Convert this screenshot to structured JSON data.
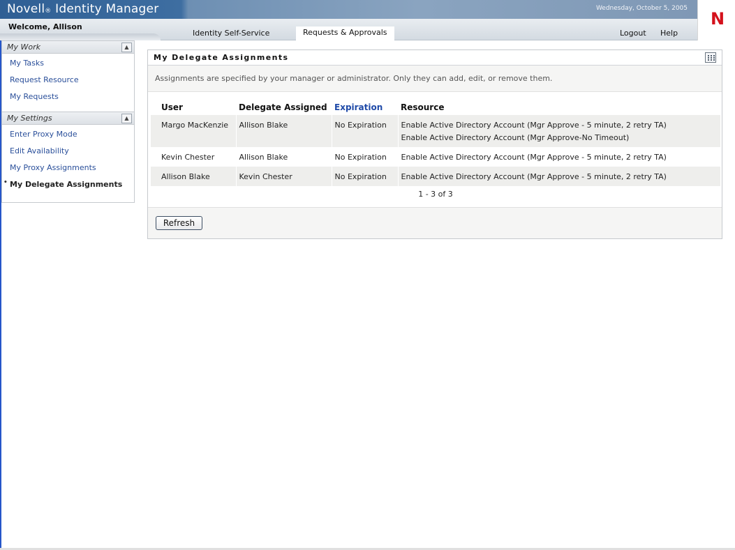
{
  "header": {
    "brand_name": "Novell",
    "brand_mark": "®",
    "brand_product": "Identity Manager",
    "date": "Wednesday, October 5, 2005",
    "logo_letter": "N",
    "welcome": "Welcome, Allison",
    "tabs": [
      {
        "label": "Identity Self-Service",
        "active": false
      },
      {
        "label": "Requests & Approvals",
        "active": true
      }
    ],
    "logout_label": "Logout",
    "help_label": "Help"
  },
  "sidebar": {
    "sections": [
      {
        "title": "My Work",
        "items": [
          {
            "label": "My Tasks"
          },
          {
            "label": "Request Resource"
          },
          {
            "label": "My Requests"
          }
        ]
      },
      {
        "title": "My Settings",
        "items": [
          {
            "label": "Enter Proxy Mode"
          },
          {
            "label": "Edit Availability"
          },
          {
            "label": "My Proxy Assignments"
          },
          {
            "label": "My Delegate Assignments",
            "active": true
          }
        ]
      }
    ],
    "collapse_icon": "double-chevron-up-icon"
  },
  "panel": {
    "title": "My Delegate Assignments",
    "menu_icon": "grid-menu-icon",
    "description": "Assignments are specified by your manager or administrator. Only they can add, edit, or remove them.",
    "columns": [
      "User",
      "Delegate Assigned",
      "Expiration",
      "Resource"
    ],
    "sort_column": "Expiration",
    "rows": [
      {
        "user": "Margo MacKenzie",
        "delegate": "Allison Blake",
        "expiration": "No Expiration",
        "resources": [
          "Enable Active Directory Account (Mgr Approve - 5 minute, 2 retry TA)",
          "Enable Active Directory Account (Mgr Approve-No Timeout)"
        ]
      },
      {
        "user": "Kevin Chester",
        "delegate": "Allison Blake",
        "expiration": "No Expiration",
        "resources": [
          "Enable Active Directory Account (Mgr Approve - 5 minute, 2 retry TA)"
        ]
      },
      {
        "user": "Allison Blake",
        "delegate": "Kevin Chester",
        "expiration": "No Expiration",
        "resources": [
          "Enable Active Directory Account (Mgr Approve - 5 minute, 2 retry TA)"
        ]
      }
    ],
    "pager": "1 - 3 of 3",
    "refresh_label": "Refresh"
  },
  "colors": {
    "link": "#2a4f9a",
    "sort_header": "#1f4aa8",
    "logo_red": "#d4111c",
    "banner_blue": "#2f5f94"
  }
}
